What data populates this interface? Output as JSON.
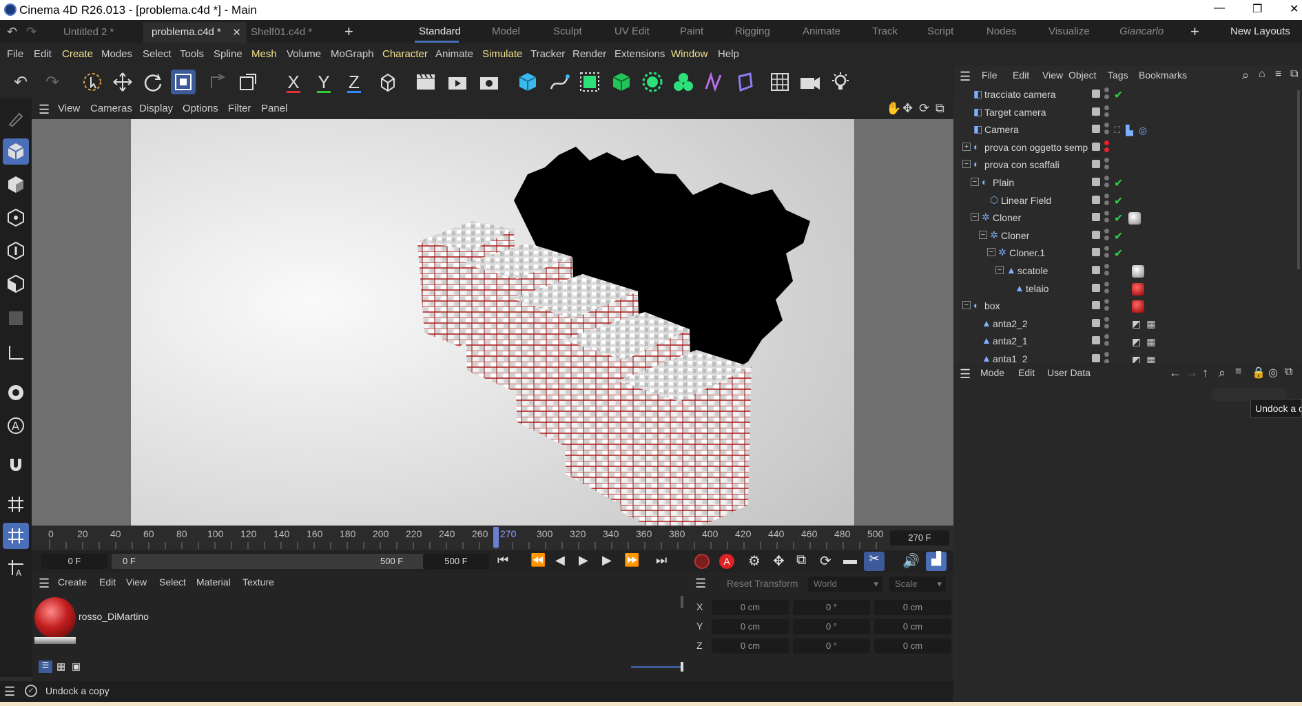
{
  "window": {
    "title": "Cinema 4D R26.013 - [problema.c4d *] - Main",
    "min": "—",
    "max": "❐",
    "close": "✕"
  },
  "file_tabs": [
    {
      "label": "Untitled 2 *"
    },
    {
      "label": "problema.c4d *",
      "close": "✕"
    },
    {
      "label": "Shelf01.c4d *"
    }
  ],
  "add_tab": "+",
  "layout_tabs": [
    "Standard",
    "Model",
    "Sculpt",
    "UV Edit",
    "Paint",
    "Rigging",
    "Animate",
    "Track",
    "Script",
    "Nodes",
    "Visualize",
    "Giancarlo"
  ],
  "layout_add": "+",
  "new_layouts": "New Layouts",
  "menu": [
    "File",
    "Edit",
    "Create",
    "Modes",
    "Select",
    "Tools",
    "Spline",
    "Mesh",
    "Volume",
    "MoGraph",
    "Character",
    "Animate",
    "Simulate",
    "Tracker",
    "Render",
    "Extensions",
    "Window",
    "Help"
  ],
  "axis_buttons": {
    "x": "X",
    "y": "Y",
    "z": "Z"
  },
  "viewport_menu": [
    "View",
    "Cameras",
    "Display",
    "Options",
    "Filter",
    "Panel"
  ],
  "timeline": {
    "ticks": [
      "0",
      "20",
      "40",
      "60",
      "80",
      "100",
      "120",
      "140",
      "160",
      "180",
      "200",
      "220",
      "240",
      "260",
      "270",
      "300",
      "320",
      "340",
      "360",
      "380",
      "400",
      "420",
      "440",
      "460",
      "480",
      "500"
    ],
    "current": "270 F",
    "current_marker": "270"
  },
  "transport": {
    "start": "0 F",
    "range_start": "0 F",
    "range_end": "500 F",
    "end": "500 F",
    "record_a": "A"
  },
  "material_panel": {
    "menu": [
      "Create",
      "Edit",
      "View",
      "Select",
      "Material",
      "Texture"
    ],
    "material_name": "rosso_DiMartino"
  },
  "coord_panel": {
    "reset": "Reset Transform",
    "space": "World",
    "mode": "Scale",
    "rows": [
      {
        "axis": "X",
        "pos": "0 cm",
        "rot": "0 °",
        "scale": "0 cm"
      },
      {
        "axis": "Y",
        "pos": "0 cm",
        "rot": "0 °",
        "scale": "0 cm"
      },
      {
        "axis": "Z",
        "pos": "0 cm",
        "rot": "0 °",
        "scale": "0 cm"
      }
    ]
  },
  "status": "Undock a copy",
  "object_panel": {
    "menu": [
      "File",
      "Edit",
      "View",
      "Object",
      "Tags",
      "Bookmarks"
    ],
    "objects": [
      {
        "name": "tracciato camera",
        "depth": 0,
        "exp": "",
        "tag": "check"
      },
      {
        "name": "Target camera",
        "depth": 0,
        "exp": "",
        "tag": ""
      },
      {
        "name": "Camera",
        "depth": 0,
        "exp": "",
        "tag": "camtags"
      },
      {
        "name": "prova con oggetto semp",
        "depth": 0,
        "exp": "+",
        "tag": "red"
      },
      {
        "name": "prova con scaffali",
        "depth": 0,
        "exp": "−",
        "tag": ""
      },
      {
        "name": "Plain",
        "depth": 1,
        "exp": "−",
        "tag": "check"
      },
      {
        "name": "Linear Field",
        "depth": 2,
        "exp": "",
        "tag": "check"
      },
      {
        "name": "Cloner",
        "depth": 1,
        "exp": "−",
        "tag": "check-white"
      },
      {
        "name": "Cloner",
        "depth": 2,
        "exp": "−",
        "tag": "check"
      },
      {
        "name": "Cloner.1",
        "depth": 3,
        "exp": "−",
        "tag": "check"
      },
      {
        "name": "scatole",
        "depth": 4,
        "exp": "−",
        "tag": "white"
      },
      {
        "name": "telaio",
        "depth": 5,
        "exp": "",
        "tag": "red-ball"
      },
      {
        "name": "box",
        "depth": 0,
        "exp": "−",
        "tag": "red-ball"
      },
      {
        "name": "anta2_2",
        "depth": 1,
        "exp": "",
        "tag": "tex"
      },
      {
        "name": "anta2_1",
        "depth": 1,
        "exp": "",
        "tag": "tex"
      },
      {
        "name": "anta1_2",
        "depth": 1,
        "exp": "",
        "tag": "tex"
      }
    ]
  },
  "attr_panel": {
    "menu": [
      "Mode",
      "Edit",
      "User Data"
    ],
    "tooltip": "Undock a c"
  },
  "colors": {
    "accent": "#4a6fb8",
    "check": "#2fcc4a",
    "highlight_menu": "#f2e28c",
    "red": "#c21d1d"
  }
}
